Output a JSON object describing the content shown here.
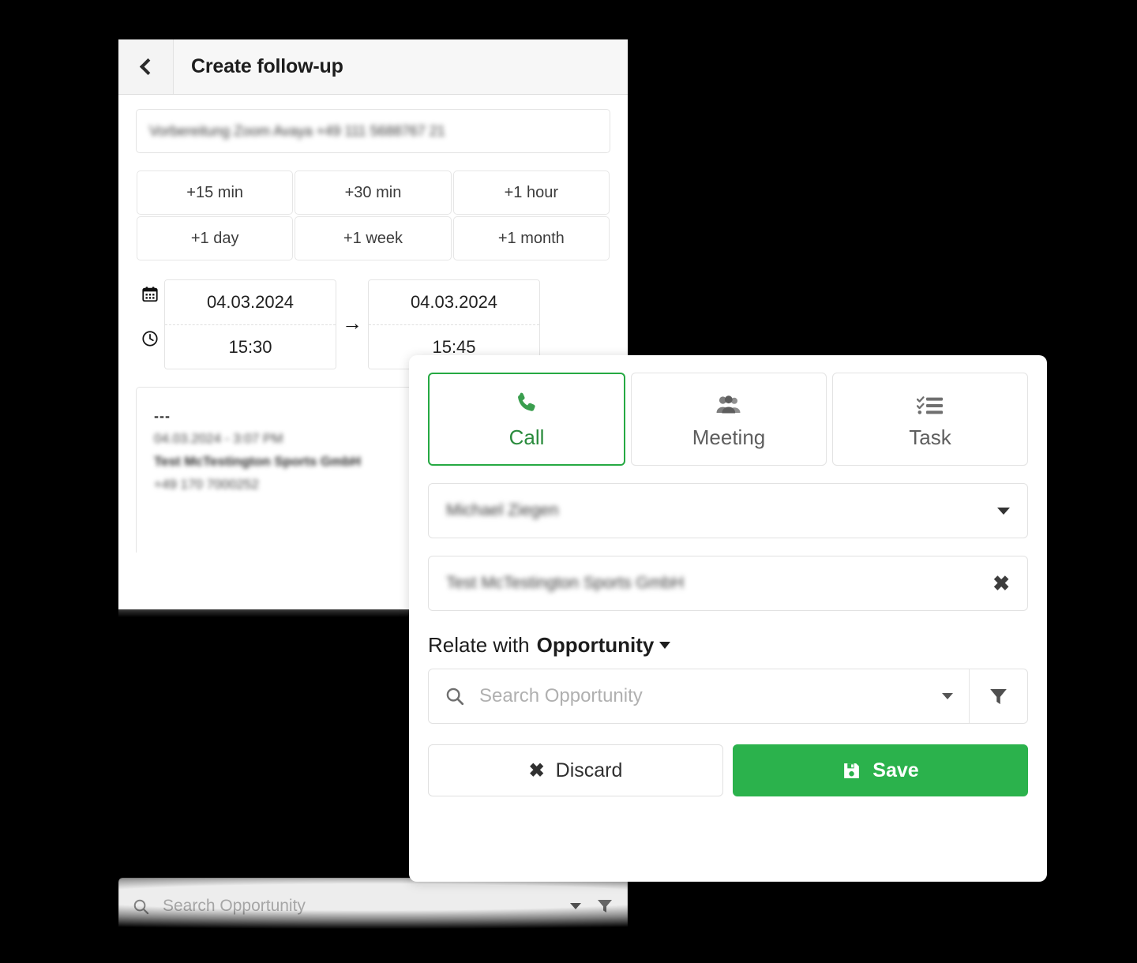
{
  "back_panel": {
    "title": "Create follow-up",
    "back_icon": "chevron-left-icon",
    "subject_value": "Vorbereitung Zoom Avaya +49 111 5688767 21",
    "quick_buttons": [
      "+15 min",
      "+30 min",
      "+1 hour",
      "+1 day",
      "+1 week",
      "+1 month"
    ],
    "datetime": {
      "calendar_icon": "calendar-icon",
      "clock_icon": "clock-icon",
      "arrow": "→",
      "start_date": "04.03.2024",
      "start_time": "15:30",
      "end_date": "04.03.2024",
      "end_time": "15:45"
    },
    "notes": {
      "separator": "---",
      "lines": [
        "04.03.2024 - 3:07 PM",
        "Test McTestington Sports GmbH",
        "+49 170 7000252"
      ]
    }
  },
  "bottom_strip": {
    "search_icon": "search-icon",
    "placeholder": "Search Opportunity",
    "caret_icon": "chevron-down-icon",
    "filter_icon": "filter-icon"
  },
  "front_panel": {
    "type_tabs": [
      {
        "label": "Call",
        "icon": "phone-icon",
        "active": true
      },
      {
        "label": "Meeting",
        "icon": "people-icon",
        "active": false
      },
      {
        "label": "Task",
        "icon": "checklist-icon",
        "active": false
      }
    ],
    "owner_select": {
      "value": "Michael Ziegen",
      "caret_icon": "chevron-down-icon"
    },
    "contact_field": {
      "value": "Test McTestington Sports GmbH",
      "clear_icon": "close-icon"
    },
    "relate": {
      "prefix": "Relate with",
      "entity": "Opportunity",
      "caret_icon": "chevron-down-icon"
    },
    "search": {
      "search_icon": "search-icon",
      "placeholder": "Search Opportunity",
      "value": "",
      "caret_icon": "chevron-down-icon",
      "filter_icon": "filter-icon"
    },
    "actions": {
      "discard_label": "Discard",
      "discard_icon": "close-icon",
      "save_label": "Save",
      "save_icon": "floppy-save-icon"
    }
  },
  "colors": {
    "background": "#000000",
    "panel": "#ffffff",
    "accent_green": "#2bb24c",
    "active_tab_green": "#2a8b3d",
    "border": "#e3e3e3",
    "text": "#1d1d1d",
    "placeholder": "#b0b0b0"
  }
}
